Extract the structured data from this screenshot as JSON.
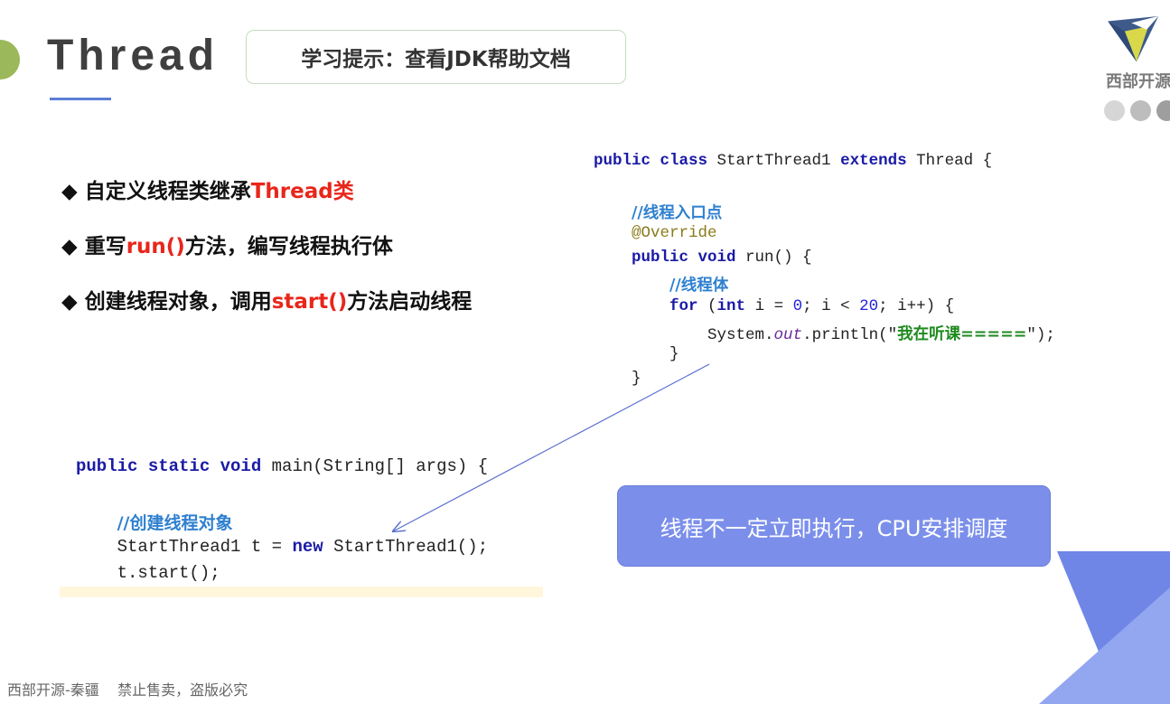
{
  "slide": {
    "title": "Thread",
    "tip": "学习提示：查看JDK帮助文档",
    "logo_text": "西部开源",
    "bullets": [
      [
        {
          "text": "◆ 自定义线程类继承",
          "red": false
        },
        {
          "text": "Thread类",
          "red": true
        }
      ],
      [
        {
          "text": "◆ 重写",
          "red": false
        },
        {
          "text": "run()",
          "red": true
        },
        {
          "text": "方法，编写线程执行体",
          "red": false
        }
      ],
      [
        {
          "text": "◆ 创建线程对象，调用",
          "red": false
        },
        {
          "text": "start()",
          "red": true
        },
        {
          "text": "方法启动线程",
          "red": false
        }
      ]
    ],
    "callout": "线程不一定立即执行，CPU安排调度",
    "footer": "西部开源-秦疆    禁止售卖，盗版必究",
    "colors": {
      "accent": "#7b8fea",
      "red": "#e8261b",
      "title": "#3f3f3f"
    }
  },
  "code_right": [
    [
      [
        "k",
        "public class "
      ],
      [
        "",
        "StartThread1 "
      ],
      [
        "k",
        "extends "
      ],
      [
        "",
        "Thread {"
      ]
    ],
    [],
    [
      [
        "",
        "    "
      ],
      [
        "cm",
        "//线程入口点"
      ]
    ],
    [
      [
        "",
        "    "
      ],
      [
        "an",
        "@Override"
      ]
    ],
    [
      [
        "",
        "    "
      ],
      [
        "k",
        "public void "
      ],
      [
        "",
        "run() {"
      ]
    ],
    [
      [
        "",
        "        "
      ],
      [
        "cm",
        "//线程体"
      ]
    ],
    [
      [
        "",
        "        "
      ],
      [
        "k",
        "for "
      ],
      [
        "",
        "("
      ],
      [
        "k",
        "int "
      ],
      [
        "",
        "i = "
      ],
      [
        "num",
        "0"
      ],
      [
        "",
        "; i < "
      ],
      [
        "num",
        "20"
      ],
      [
        "",
        "; i++) {"
      ]
    ],
    [
      [
        "",
        "            System."
      ],
      [
        "it",
        "out"
      ],
      [
        "",
        ".println(\""
      ],
      [
        "str",
        "我在听课====="
      ],
      [
        "",
        "\");"
      ]
    ],
    [
      [
        "",
        "        }"
      ]
    ],
    [
      [
        "",
        "    }"
      ]
    ]
  ],
  "code_left": [
    [
      [
        "k",
        "public static void "
      ],
      [
        "",
        "main(String[] args) {"
      ]
    ],
    [],
    [
      [
        "",
        "    "
      ],
      [
        "cm",
        "//创建线程对象"
      ]
    ],
    [
      [
        "",
        "    StartThread1 t = "
      ],
      [
        "k",
        "new "
      ],
      [
        "",
        "StartThread1();"
      ]
    ],
    [
      [
        "",
        "    t.start();"
      ]
    ]
  ]
}
